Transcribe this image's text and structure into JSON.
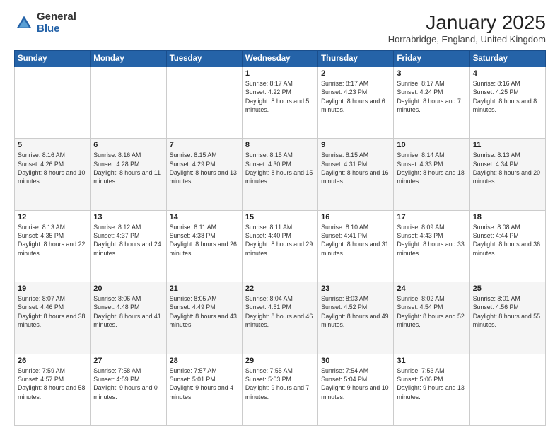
{
  "logo": {
    "general": "General",
    "blue": "Blue"
  },
  "header": {
    "month": "January 2025",
    "location": "Horrabridge, England, United Kingdom"
  },
  "weekdays": [
    "Sunday",
    "Monday",
    "Tuesday",
    "Wednesday",
    "Thursday",
    "Friday",
    "Saturday"
  ],
  "weeks": [
    [
      {
        "day": "",
        "sunrise": "",
        "sunset": "",
        "daylight": ""
      },
      {
        "day": "",
        "sunrise": "",
        "sunset": "",
        "daylight": ""
      },
      {
        "day": "",
        "sunrise": "",
        "sunset": "",
        "daylight": ""
      },
      {
        "day": "1",
        "sunrise": "Sunrise: 8:17 AM",
        "sunset": "Sunset: 4:22 PM",
        "daylight": "Daylight: 8 hours and 5 minutes."
      },
      {
        "day": "2",
        "sunrise": "Sunrise: 8:17 AM",
        "sunset": "Sunset: 4:23 PM",
        "daylight": "Daylight: 8 hours and 6 minutes."
      },
      {
        "day": "3",
        "sunrise": "Sunrise: 8:17 AM",
        "sunset": "Sunset: 4:24 PM",
        "daylight": "Daylight: 8 hours and 7 minutes."
      },
      {
        "day": "4",
        "sunrise": "Sunrise: 8:16 AM",
        "sunset": "Sunset: 4:25 PM",
        "daylight": "Daylight: 8 hours and 8 minutes."
      }
    ],
    [
      {
        "day": "5",
        "sunrise": "Sunrise: 8:16 AM",
        "sunset": "Sunset: 4:26 PM",
        "daylight": "Daylight: 8 hours and 10 minutes."
      },
      {
        "day": "6",
        "sunrise": "Sunrise: 8:16 AM",
        "sunset": "Sunset: 4:28 PM",
        "daylight": "Daylight: 8 hours and 11 minutes."
      },
      {
        "day": "7",
        "sunrise": "Sunrise: 8:15 AM",
        "sunset": "Sunset: 4:29 PM",
        "daylight": "Daylight: 8 hours and 13 minutes."
      },
      {
        "day": "8",
        "sunrise": "Sunrise: 8:15 AM",
        "sunset": "Sunset: 4:30 PM",
        "daylight": "Daylight: 8 hours and 15 minutes."
      },
      {
        "day": "9",
        "sunrise": "Sunrise: 8:15 AM",
        "sunset": "Sunset: 4:31 PM",
        "daylight": "Daylight: 8 hours and 16 minutes."
      },
      {
        "day": "10",
        "sunrise": "Sunrise: 8:14 AM",
        "sunset": "Sunset: 4:33 PM",
        "daylight": "Daylight: 8 hours and 18 minutes."
      },
      {
        "day": "11",
        "sunrise": "Sunrise: 8:13 AM",
        "sunset": "Sunset: 4:34 PM",
        "daylight": "Daylight: 8 hours and 20 minutes."
      }
    ],
    [
      {
        "day": "12",
        "sunrise": "Sunrise: 8:13 AM",
        "sunset": "Sunset: 4:35 PM",
        "daylight": "Daylight: 8 hours and 22 minutes."
      },
      {
        "day": "13",
        "sunrise": "Sunrise: 8:12 AM",
        "sunset": "Sunset: 4:37 PM",
        "daylight": "Daylight: 8 hours and 24 minutes."
      },
      {
        "day": "14",
        "sunrise": "Sunrise: 8:11 AM",
        "sunset": "Sunset: 4:38 PM",
        "daylight": "Daylight: 8 hours and 26 minutes."
      },
      {
        "day": "15",
        "sunrise": "Sunrise: 8:11 AM",
        "sunset": "Sunset: 4:40 PM",
        "daylight": "Daylight: 8 hours and 29 minutes."
      },
      {
        "day": "16",
        "sunrise": "Sunrise: 8:10 AM",
        "sunset": "Sunset: 4:41 PM",
        "daylight": "Daylight: 8 hours and 31 minutes."
      },
      {
        "day": "17",
        "sunrise": "Sunrise: 8:09 AM",
        "sunset": "Sunset: 4:43 PM",
        "daylight": "Daylight: 8 hours and 33 minutes."
      },
      {
        "day": "18",
        "sunrise": "Sunrise: 8:08 AM",
        "sunset": "Sunset: 4:44 PM",
        "daylight": "Daylight: 8 hours and 36 minutes."
      }
    ],
    [
      {
        "day": "19",
        "sunrise": "Sunrise: 8:07 AM",
        "sunset": "Sunset: 4:46 PM",
        "daylight": "Daylight: 8 hours and 38 minutes."
      },
      {
        "day": "20",
        "sunrise": "Sunrise: 8:06 AM",
        "sunset": "Sunset: 4:48 PM",
        "daylight": "Daylight: 8 hours and 41 minutes."
      },
      {
        "day": "21",
        "sunrise": "Sunrise: 8:05 AM",
        "sunset": "Sunset: 4:49 PM",
        "daylight": "Daylight: 8 hours and 43 minutes."
      },
      {
        "day": "22",
        "sunrise": "Sunrise: 8:04 AM",
        "sunset": "Sunset: 4:51 PM",
        "daylight": "Daylight: 8 hours and 46 minutes."
      },
      {
        "day": "23",
        "sunrise": "Sunrise: 8:03 AM",
        "sunset": "Sunset: 4:52 PM",
        "daylight": "Daylight: 8 hours and 49 minutes."
      },
      {
        "day": "24",
        "sunrise": "Sunrise: 8:02 AM",
        "sunset": "Sunset: 4:54 PM",
        "daylight": "Daylight: 8 hours and 52 minutes."
      },
      {
        "day": "25",
        "sunrise": "Sunrise: 8:01 AM",
        "sunset": "Sunset: 4:56 PM",
        "daylight": "Daylight: 8 hours and 55 minutes."
      }
    ],
    [
      {
        "day": "26",
        "sunrise": "Sunrise: 7:59 AM",
        "sunset": "Sunset: 4:57 PM",
        "daylight": "Daylight: 8 hours and 58 minutes."
      },
      {
        "day": "27",
        "sunrise": "Sunrise: 7:58 AM",
        "sunset": "Sunset: 4:59 PM",
        "daylight": "Daylight: 9 hours and 0 minutes."
      },
      {
        "day": "28",
        "sunrise": "Sunrise: 7:57 AM",
        "sunset": "Sunset: 5:01 PM",
        "daylight": "Daylight: 9 hours and 4 minutes."
      },
      {
        "day": "29",
        "sunrise": "Sunrise: 7:55 AM",
        "sunset": "Sunset: 5:03 PM",
        "daylight": "Daylight: 9 hours and 7 minutes."
      },
      {
        "day": "30",
        "sunrise": "Sunrise: 7:54 AM",
        "sunset": "Sunset: 5:04 PM",
        "daylight": "Daylight: 9 hours and 10 minutes."
      },
      {
        "day": "31",
        "sunrise": "Sunrise: 7:53 AM",
        "sunset": "Sunset: 5:06 PM",
        "daylight": "Daylight: 9 hours and 13 minutes."
      },
      {
        "day": "",
        "sunrise": "",
        "sunset": "",
        "daylight": ""
      }
    ]
  ]
}
